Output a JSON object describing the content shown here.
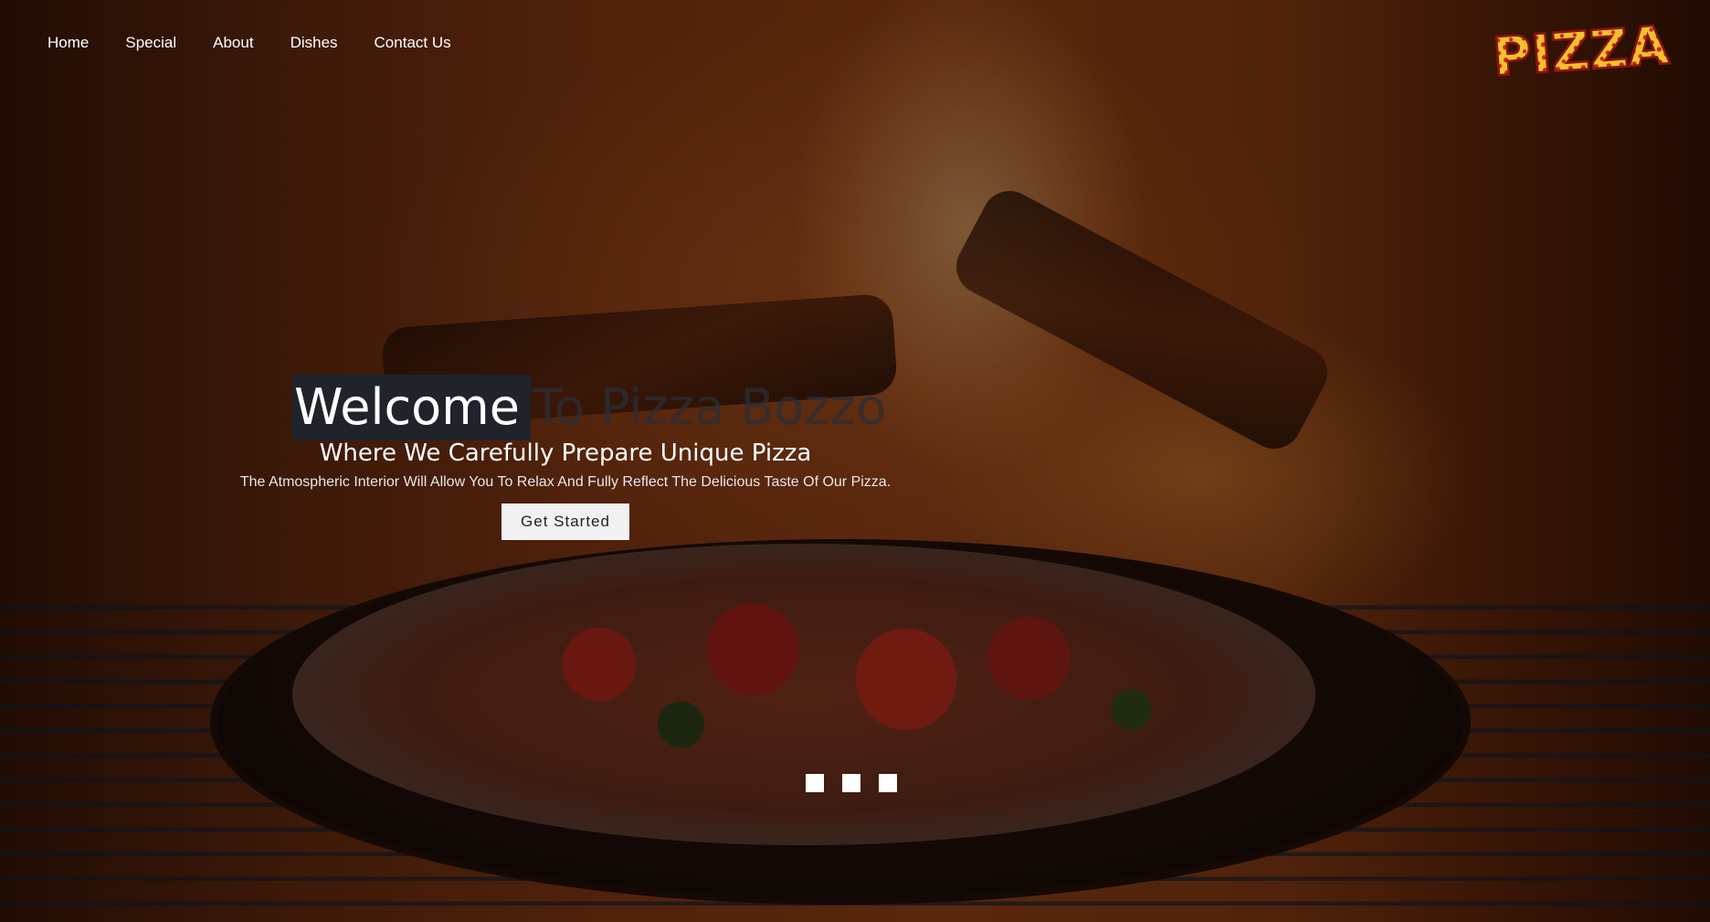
{
  "nav": {
    "items": [
      {
        "label": "Home"
      },
      {
        "label": "Special"
      },
      {
        "label": "About"
      },
      {
        "label": "Dishes"
      },
      {
        "label": "Contact Us"
      }
    ]
  },
  "logo": {
    "text": "PIZZA"
  },
  "hero": {
    "headline_highlight": "Welcome",
    "headline_rest": " To Pizza Bozzo",
    "subheading": "Where We Carefully Prepare Unique Pizza",
    "tagline": "The Atmospheric Interior Will Allow You To Relax And Fully Reflect The Delicious Taste Of Our Pizza.",
    "cta_label": "Get Started",
    "slides": 3
  },
  "colors": {
    "overlay": "#000000",
    "headline_bg": "#1f242b",
    "cta_bg": "#f1f1f1",
    "logo_red": "#c8271e",
    "logo_yellow": "#f2c12e"
  }
}
